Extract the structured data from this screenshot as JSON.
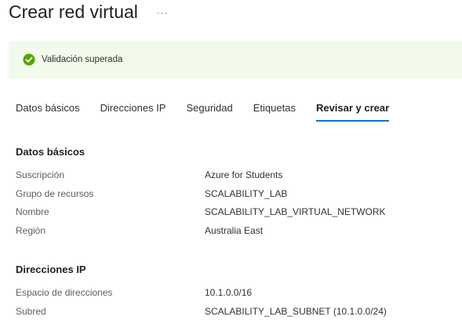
{
  "header": {
    "title": "Crear red virtual",
    "more_label": "···"
  },
  "banner": {
    "icon": "check-circle-icon",
    "text": "Validación superada",
    "color": "#57a300",
    "background": "#f1faeb"
  },
  "tabs": [
    {
      "label": "Datos básicos",
      "active": false
    },
    {
      "label": "Direcciones IP",
      "active": false
    },
    {
      "label": "Seguridad",
      "active": false
    },
    {
      "label": "Etiquetas",
      "active": false
    },
    {
      "label": "Revisar y crear",
      "active": true
    }
  ],
  "accent_color": "#0078d4",
  "sections": {
    "basics": {
      "title": "Datos básicos",
      "rows": [
        {
          "label": "Suscripción",
          "value": "Azure for Students"
        },
        {
          "label": "Grupo de recursos",
          "value": "SCALABILITY_LAB"
        },
        {
          "label": "Nombre",
          "value": "SCALABILITY_LAB_VIRTUAL_NETWORK"
        },
        {
          "label": "Región",
          "value": "Australia East"
        }
      ]
    },
    "ip": {
      "title": "Direcciones IP",
      "rows": [
        {
          "label": "Espacio de direcciones",
          "value": "10.1.0.0/16"
        },
        {
          "label": "Subred",
          "value": "SCALABILITY_LAB_SUBNET (10.1.0.0/24)"
        }
      ]
    }
  }
}
